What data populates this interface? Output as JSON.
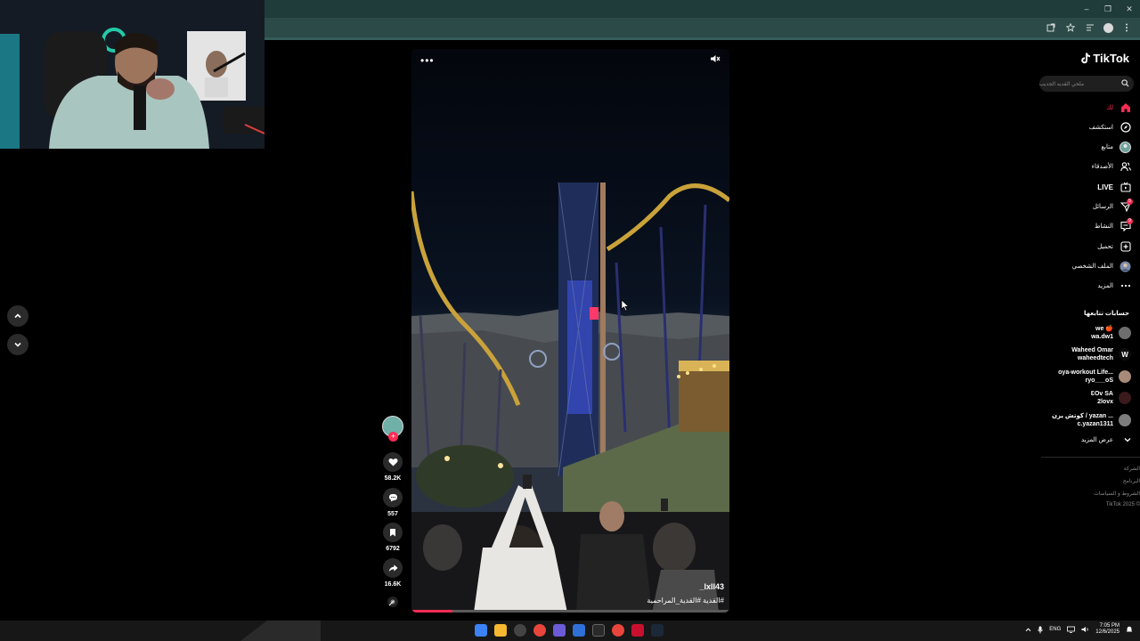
{
  "browser": {
    "window_controls": [
      "–",
      "❐",
      "✕"
    ]
  },
  "video": {
    "more_glyph": "•••",
    "username": "_lxll43",
    "hashtags": "#القدية #القدية_المراحمية",
    "progress": 0.13
  },
  "actions": {
    "likes": "58.2K",
    "comments": "557",
    "saves": "6792",
    "shares": "16.6K"
  },
  "sidebar": {
    "logo_text": "TikTok",
    "search_placeholder": "ملحي القديه الجديب",
    "nav": [
      {
        "label": "لك",
        "icon": "home-icon",
        "active": true
      },
      {
        "label": "استكشف",
        "icon": "compass-icon"
      },
      {
        "label": "متابع",
        "icon": "following-avatar-icon"
      },
      {
        "label": "الأصدقاء",
        "icon": "friends-icon"
      },
      {
        "label": "LIVE",
        "icon": "live-icon"
      },
      {
        "label": "الرسائل",
        "icon": "messages-icon",
        "badge": "5"
      },
      {
        "label": "النشاط",
        "icon": "activity-icon",
        "badge": "9"
      },
      {
        "label": "تحميل",
        "icon": "upload-icon"
      },
      {
        "label": "الملف الشخصي",
        "icon": "profile-icon"
      },
      {
        "label": "المزيد",
        "icon": "more-icon"
      }
    ],
    "following_title": "حسابات تتابعها",
    "accounts": [
      {
        "line1": "we 🍎",
        "line2": "wa.dw1"
      },
      {
        "line1": "Waheed Omar",
        "line2": "waheedtech"
      },
      {
        "line1": "oya-workout Life...",
        "line2": "ryo___oS"
      },
      {
        "line1": "ƐOv SA",
        "line2": "2lovx"
      },
      {
        "line1": "كوتش يزن / yazan ...",
        "line2": "c.yazan1311"
      }
    ],
    "see_more": "عرض المزيد",
    "footer": [
      "الشركة",
      "البرنامج",
      "الشروط و السياسات",
      "TikTok 2025 ©"
    ]
  },
  "taskbar": {
    "lang": "ENG",
    "time": "7:05 PM",
    "date": "12/6/2025"
  }
}
